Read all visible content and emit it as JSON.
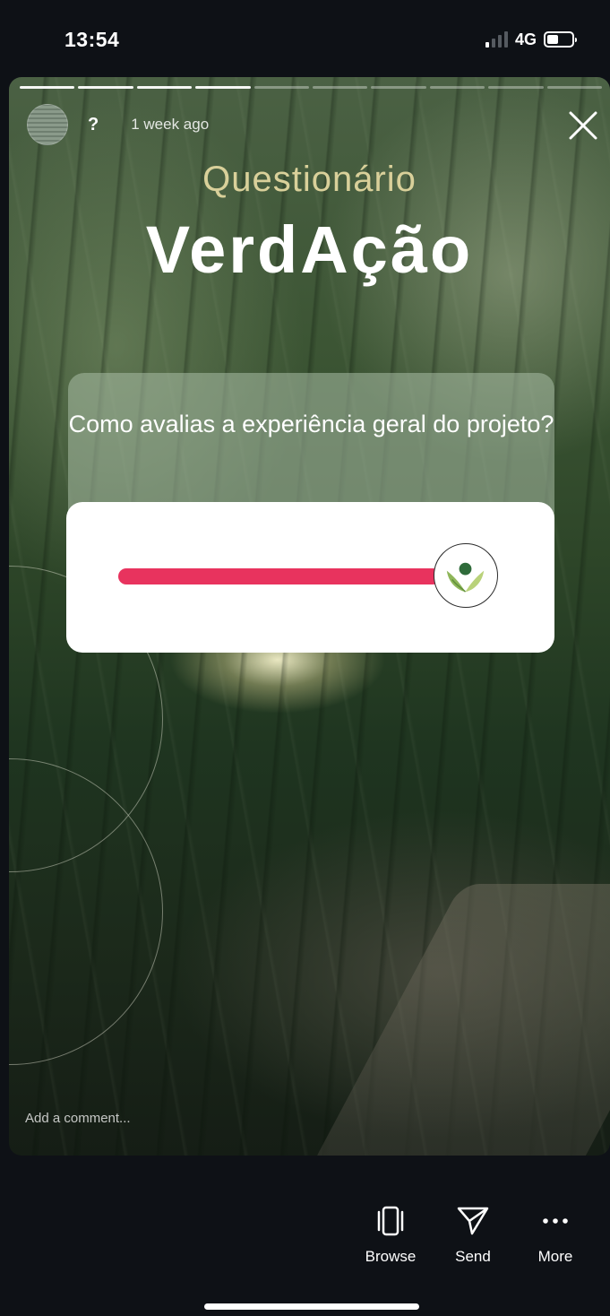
{
  "status_bar": {
    "time": "13:54",
    "network": "4G",
    "battery_level": 0.45
  },
  "story": {
    "username": "?",
    "posted": "1 week ago",
    "subtitle": "Questionário",
    "title": "VerdAção",
    "progress": {
      "total_segments": 10,
      "completed_segments": 4
    },
    "poll": {
      "question": "Como avalias a experiência geral do projeto?",
      "slider_value": 1.0,
      "slider_color": "#e8335e",
      "thumb_icon": "leaf-logo-icon"
    },
    "comment_placeholder": "Add a comment..."
  },
  "actions": [
    {
      "label": "Browse",
      "icon": "browse-icon"
    },
    {
      "label": "Send",
      "icon": "send-icon"
    },
    {
      "label": "More",
      "icon": "more-icon"
    }
  ]
}
